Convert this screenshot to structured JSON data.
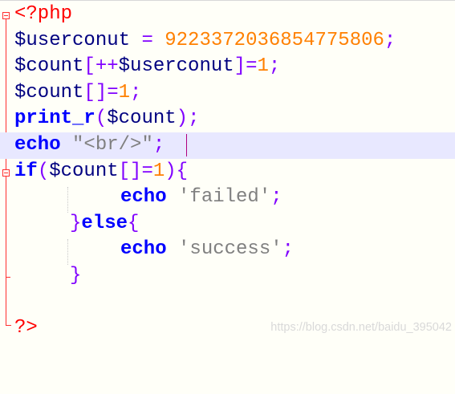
{
  "code": {
    "php_open": "<?php",
    "php_close": "?>",
    "var_userconut": "$userconut",
    "var_count": "$count",
    "assign": "=",
    "big_number": "9223372036854775806",
    "semicolon": ";",
    "bracket_open": "[",
    "bracket_close": "]",
    "increment": "++",
    "one": "1",
    "empty_brackets": "[]",
    "print_r": "print_r",
    "paren_open": "(",
    "paren_close": ")",
    "echo": "echo",
    "br_quote_open": "\"",
    "br_text": "<br/>",
    "br_quote_close": "\"",
    "if_kw": "if",
    "else_kw": "else",
    "brace_open": "{",
    "brace_close": "}",
    "str_failed": "'failed'",
    "str_success": "'success'"
  },
  "watermark": "https://blog.csdn.net/baidu_395042"
}
